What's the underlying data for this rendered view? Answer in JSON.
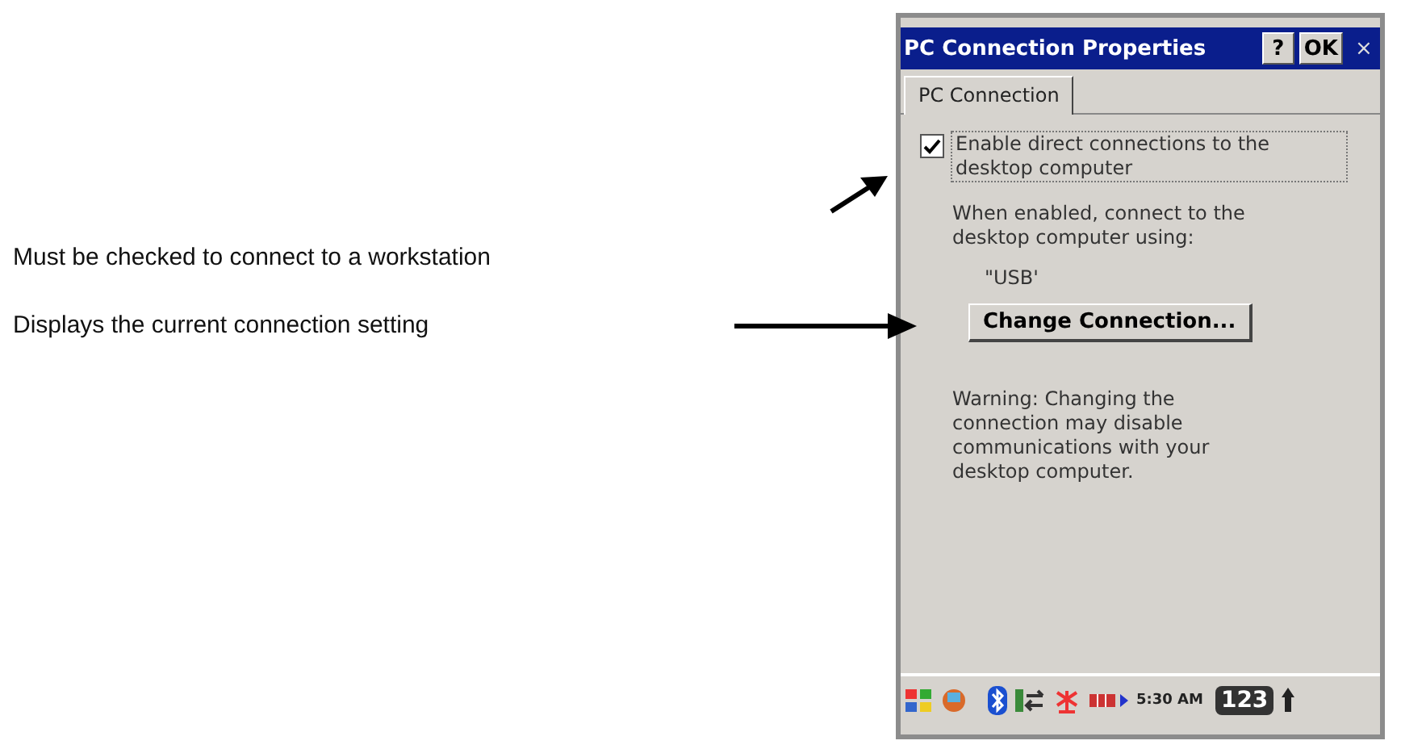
{
  "annotations": [
    {
      "text": "Must be checked to connect to a workstation"
    },
    {
      "text": "Displays the current connection setting"
    }
  ],
  "window": {
    "title": "PC Connection Properties",
    "buttons": [
      "?",
      "OK",
      "×"
    ]
  },
  "tabs": [
    {
      "label": "PC Connection",
      "selected": true
    }
  ],
  "enable_checkbox": {
    "label": "Enable direct connections to the desktop computer",
    "checked": true
  },
  "connection_info": "When enabled, connect to the desktop computer using:",
  "current_connection": "\"USB'",
  "change_button": "Change Connection...",
  "warning": "Warning: Changing the connection may disable communications with your desktop computer.",
  "taskbar": {
    "time": "5:30 AM",
    "input_mode": "123"
  }
}
